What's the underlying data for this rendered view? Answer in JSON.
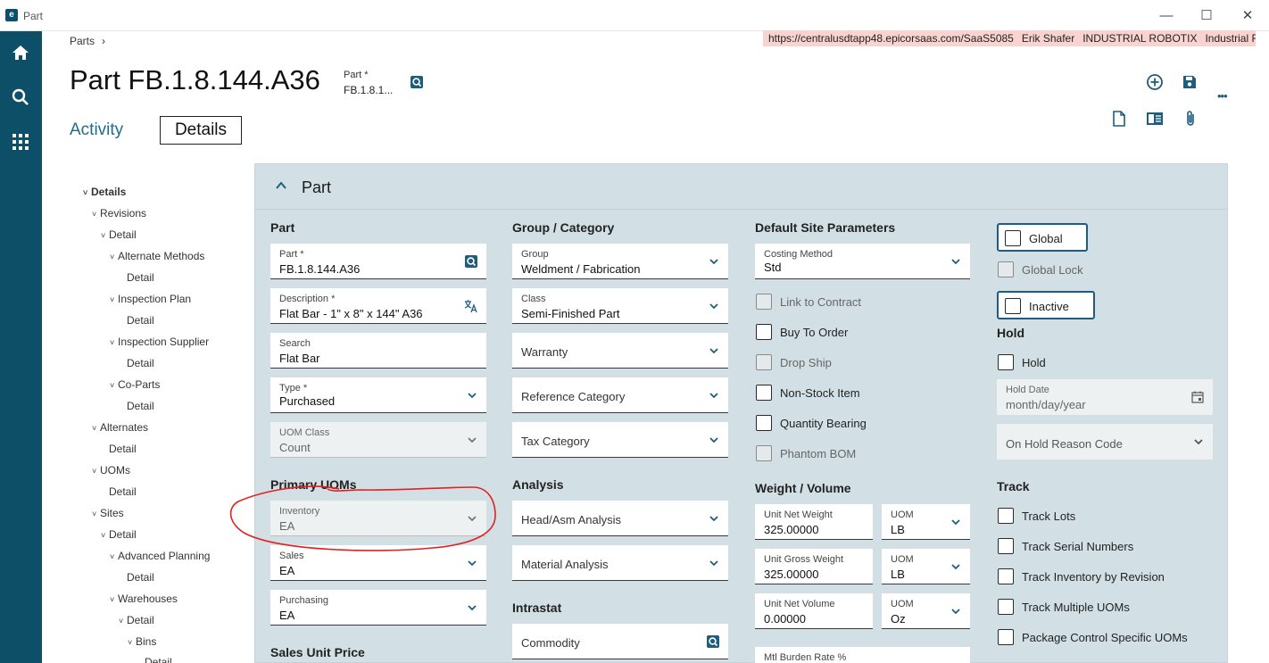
{
  "window": {
    "title": "Part",
    "app_logo": "e",
    "minimize": "—",
    "maximize": "☐",
    "close": "✕"
  },
  "rail": {
    "icons": [
      "home-icon",
      "search-icon",
      "apps-grid-icon"
    ]
  },
  "breadcrumb": {
    "item": "Parts",
    "separator": "›"
  },
  "environment": {
    "url": "https://centralusdtapp48.epicorsaas.com/SaaS5085",
    "user": "Erik Shafer",
    "company_code": "INDUSTRIAL ROBOTIX",
    "company_name": "Industrial Robotix"
  },
  "header": {
    "title": "Part FB.1.8.144.A36",
    "key_label": "Part *",
    "key_value": "FB.1.8.1...",
    "tabs": {
      "activity": "Activity",
      "details": "Details"
    },
    "toolbar_icons": [
      "add-new-icon",
      "save-icon",
      "more-icon",
      "document-icon",
      "panel-card-icon",
      "attachment-icon"
    ],
    "more": "•••"
  },
  "tree": [
    {
      "label": "Details",
      "chev": "˅"
    },
    {
      "label": "Revisions",
      "chev": "˅"
    },
    {
      "label": "Detail",
      "chev": "˅"
    },
    {
      "label": "Alternate Methods",
      "chev": "˅"
    },
    {
      "label": "Detail",
      "chev": ""
    },
    {
      "label": "Inspection Plan",
      "chev": "˅"
    },
    {
      "label": "Detail",
      "chev": ""
    },
    {
      "label": "Inspection Supplier",
      "chev": "˅"
    },
    {
      "label": "Detail",
      "chev": ""
    },
    {
      "label": "Co-Parts",
      "chev": "˅"
    },
    {
      "label": "Detail",
      "chev": ""
    },
    {
      "label": "Alternates",
      "chev": "˅"
    },
    {
      "label": "Detail",
      "chev": ""
    },
    {
      "label": "UOMs",
      "chev": "˅"
    },
    {
      "label": "Detail",
      "chev": ""
    },
    {
      "label": "Sites",
      "chev": "˅"
    },
    {
      "label": "Detail",
      "chev": "˅"
    },
    {
      "label": "Advanced Planning",
      "chev": "˅"
    },
    {
      "label": "Detail",
      "chev": ""
    },
    {
      "label": "Warehouses",
      "chev": "˅"
    },
    {
      "label": "Detail",
      "chev": "˅"
    },
    {
      "label": "Bins",
      "chev": "˅"
    },
    {
      "label": "Detail",
      "chev": ""
    }
  ],
  "panel": {
    "title": "Part"
  },
  "col1": {
    "title": "Part",
    "part": {
      "label": "Part *",
      "value": "FB.1.8.144.A36"
    },
    "description": {
      "label": "Description *",
      "value": "Flat Bar - 1\" x 8\" x 144\" A36"
    },
    "search": {
      "label": "Search",
      "value": "Flat Bar"
    },
    "type": {
      "label": "Type *",
      "value": "Purchased"
    },
    "uom_class": {
      "label": "UOM Class",
      "value": "Count"
    },
    "primary_uoms_title": "Primary UOMs",
    "inventory": {
      "label": "Inventory",
      "value": "EA"
    },
    "sales": {
      "label": "Sales",
      "value": "EA"
    },
    "purchasing": {
      "label": "Purchasing",
      "value": "EA"
    },
    "sales_unit_price_title": "Sales Unit Price"
  },
  "col2": {
    "title": "Group / Category",
    "group": {
      "label": "Group",
      "value": "Weldment / Fabrication"
    },
    "class": {
      "label": "Class",
      "value": "Semi-Finished Part"
    },
    "warranty": "Warranty",
    "reference_category": "Reference Category",
    "tax_category": "Tax Category",
    "analysis_title": "Analysis",
    "head_asm_analysis": "Head/Asm Analysis",
    "material_analysis": "Material Analysis",
    "intrastat_title": "Intrastat",
    "commodity": "Commodity"
  },
  "col3": {
    "title": "Default Site Parameters",
    "costing_method": {
      "label": "Costing Method",
      "value": "Std"
    },
    "link_to_contract": "Link to Contract",
    "buy_to_order": "Buy To Order",
    "drop_ship": "Drop Ship",
    "non_stock_item": "Non-Stock Item",
    "quantity_bearing": "Quantity Bearing",
    "phantom_bom": "Phantom BOM",
    "weight_volume_title": "Weight / Volume",
    "unit_net_weight": {
      "label": "Unit Net Weight",
      "value": "325.00000"
    },
    "net_weight_uom": {
      "label": "UOM",
      "value": "LB"
    },
    "unit_gross_weight": {
      "label": "Unit Gross Weight",
      "value": "325.00000"
    },
    "gross_weight_uom": {
      "label": "UOM",
      "value": "LB"
    },
    "unit_net_volume": {
      "label": "Unit Net Volume",
      "value": "0.00000"
    },
    "net_volume_uom": {
      "label": "UOM",
      "value": "Oz"
    },
    "mtl_burden_rate": {
      "label": "Mtl Burden Rate %"
    }
  },
  "col4": {
    "global": "Global",
    "global_lock": "Global Lock",
    "inactive": "Inactive",
    "hold_title": "Hold",
    "hold": "Hold",
    "hold_date": {
      "label": "Hold Date",
      "placeholder": "month/day/year"
    },
    "on_hold_reason_code": "On Hold Reason Code",
    "track_title": "Track",
    "track_lots": "Track Lots",
    "track_serial_numbers": "Track Serial Numbers",
    "track_inventory_by_revision": "Track Inventory by Revision",
    "track_multiple_uoms": "Track Multiple UOMs",
    "package_control_specific_uoms": "Package Control Specific UOMs"
  },
  "colors": {
    "rail": "#0e4f68",
    "panel": "#d2e0e5",
    "link": "#1f6b92",
    "annotation": "#e0211f",
    "env_bar": "#f9d3d0"
  }
}
